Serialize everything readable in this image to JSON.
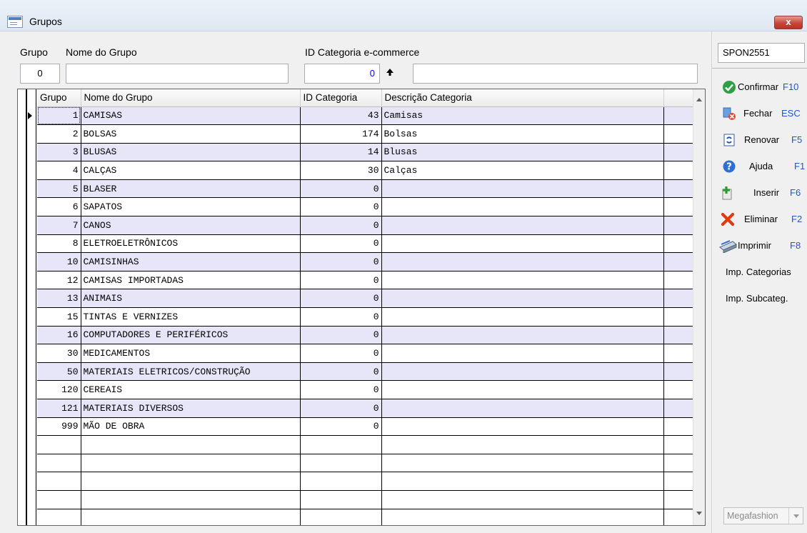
{
  "window": {
    "title": "Grupos",
    "close_label": "x"
  },
  "filters": {
    "group_label": "Grupo",
    "group_name_label": "Nome do Grupo",
    "category_label": "ID Categoria e-commerce",
    "group_value": "0",
    "group_name_value": "",
    "category_value": "0",
    "category_desc_value": ""
  },
  "grid": {
    "columns": [
      "Grupo",
      "Nome do Grupo",
      "ID Categoria",
      "Descrição Categoria"
    ],
    "rows": [
      [
        "1",
        "CAMISAS",
        "43",
        "Camisas"
      ],
      [
        "2",
        "BOLSAS",
        "174",
        "Bolsas"
      ],
      [
        "3",
        "BLUSAS",
        "14",
        "Blusas"
      ],
      [
        "4",
        "CALÇAS",
        "30",
        "Calças"
      ],
      [
        "5",
        "BLASER",
        "0",
        ""
      ],
      [
        "6",
        "SAPATOS",
        "0",
        ""
      ],
      [
        "7",
        "CANOS",
        "0",
        ""
      ],
      [
        "8",
        "ELETROELETRÔNICOS",
        "0",
        ""
      ],
      [
        "10",
        "CAMISINHAS",
        "0",
        ""
      ],
      [
        "12",
        "CAMISAS IMPORTADAS",
        "0",
        ""
      ],
      [
        "13",
        "ANIMAIS",
        "0",
        ""
      ],
      [
        "15",
        "TINTAS E VERNIZES",
        "0",
        ""
      ],
      [
        "16",
        "COMPUTADORES E PERIFÉRICOS",
        "0",
        ""
      ],
      [
        "30",
        "MEDICAMENTOS",
        "0",
        ""
      ],
      [
        "50",
        "MATERIAIS ELETRICOS/CONSTRUÇÃO",
        "0",
        ""
      ],
      [
        "120",
        "CEREAIS",
        "0",
        ""
      ],
      [
        "121",
        "MATERIAIS DIVERSOS",
        "0",
        ""
      ],
      [
        "999",
        "MÃO DE OBRA",
        "0",
        ""
      ]
    ],
    "empty_rows": 5
  },
  "side": {
    "code": "SPON2551",
    "confirm": {
      "label": "Confirmar",
      "key": "F10"
    },
    "close": {
      "label": "Fechar",
      "key": "ESC"
    },
    "renew": {
      "label": "Renovar",
      "key": "F5"
    },
    "help": {
      "label": "Ajuda",
      "key": "F1"
    },
    "insert": {
      "label": "Inserir",
      "key": "F6"
    },
    "delete": {
      "label": "Eliminar",
      "key": "F2"
    },
    "print": {
      "label": "Imprimir",
      "key": "F8"
    },
    "imp_categories": "Imp. Categorias",
    "imp_subcategories": "Imp. Subcateg.",
    "company": "Megafashion"
  },
  "colors": {
    "alt_row": "#e6e6f8",
    "key_text": "#1e57c9",
    "close_button": "#c7473a"
  }
}
